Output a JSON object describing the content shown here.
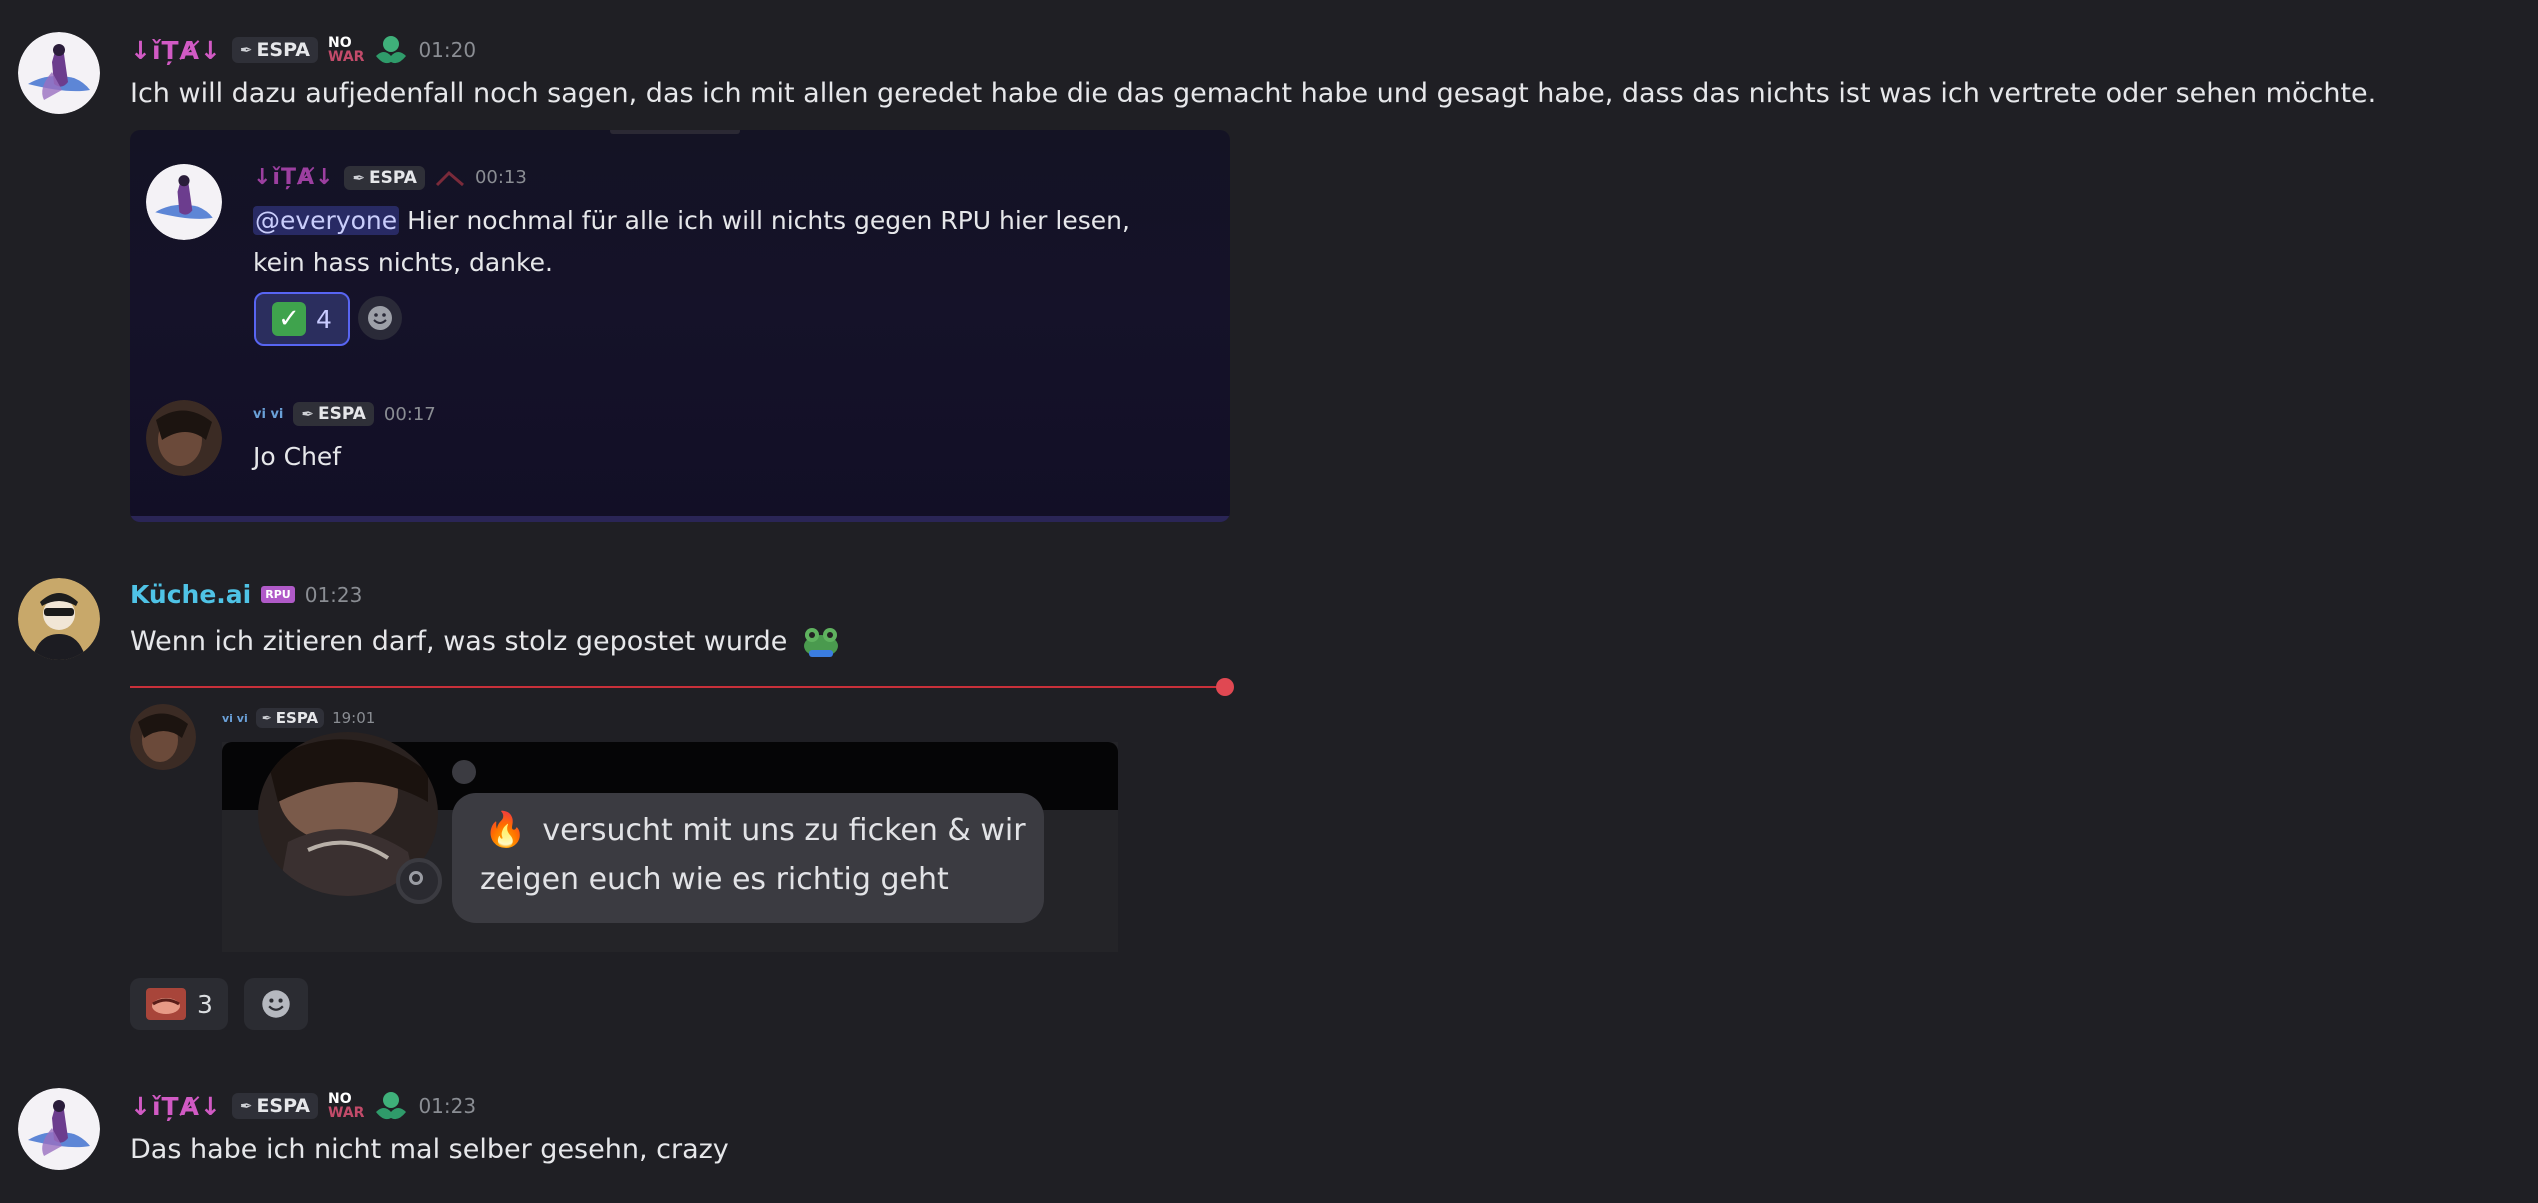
{
  "colors": {
    "background": "#1f1f24",
    "username_purple": "#d15ac4",
    "username_cyan": "#4fc3e6",
    "divider_red": "#c9303a",
    "reaction_active_border": "#5865f2"
  },
  "msg1": {
    "username": "↓ǐȚȺ↓",
    "tag": "ESPA",
    "badge_text_1": "NO",
    "badge_text_2": "WAR",
    "badge_icon": "green-hands-icon",
    "timestamp": "01:20",
    "text": "Ich will dazu aufjedenfall noch sagen, das ich mit allen geredet habe die das gemacht habe und gesagt habe, dass das nichts ist was ich vertrete oder sehen möchte."
  },
  "forward": {
    "post1": {
      "username": "↓ǐȚȺ↓",
      "tag": "ESPA",
      "timestamp": "00:13",
      "mention": "@everyone",
      "text_line1": " Hier nochmal für alle ich will nichts gegen RPU hier lesen,",
      "text_line2": "kein hass nichts, danke.",
      "reaction_emoji": "check-mark-icon",
      "reaction_count": "4"
    },
    "post2": {
      "username": "vi vi",
      "tag": "ESPA",
      "timestamp": "00:17",
      "text": "Jo Chef"
    }
  },
  "msg2": {
    "username": "Küche.ai",
    "badge": "RPU",
    "timestamp": "01:23",
    "text": "Wenn ich zitieren darf, was stolz gepostet wurde",
    "emoji": "frog-emoji",
    "quote": {
      "username": "vi vi",
      "tag": "ESPA",
      "timestamp": "19:01",
      "fire_emoji": "🔥",
      "bubble_line1": "versucht mit uns zu ficken & wir",
      "bubble_line2": "zeigen euch wie es richtig geht"
    },
    "reaction_emoji": "sticker-reaction-icon",
    "reaction_count": "3"
  },
  "msg3": {
    "username": "↓ǐȚȺ↓",
    "tag": "ESPA",
    "badge_text_1": "NO",
    "badge_text_2": "WAR",
    "badge_icon": "green-hands-icon",
    "timestamp": "01:23",
    "text": "Das habe ich nicht mal selber gesehn, crazy"
  }
}
